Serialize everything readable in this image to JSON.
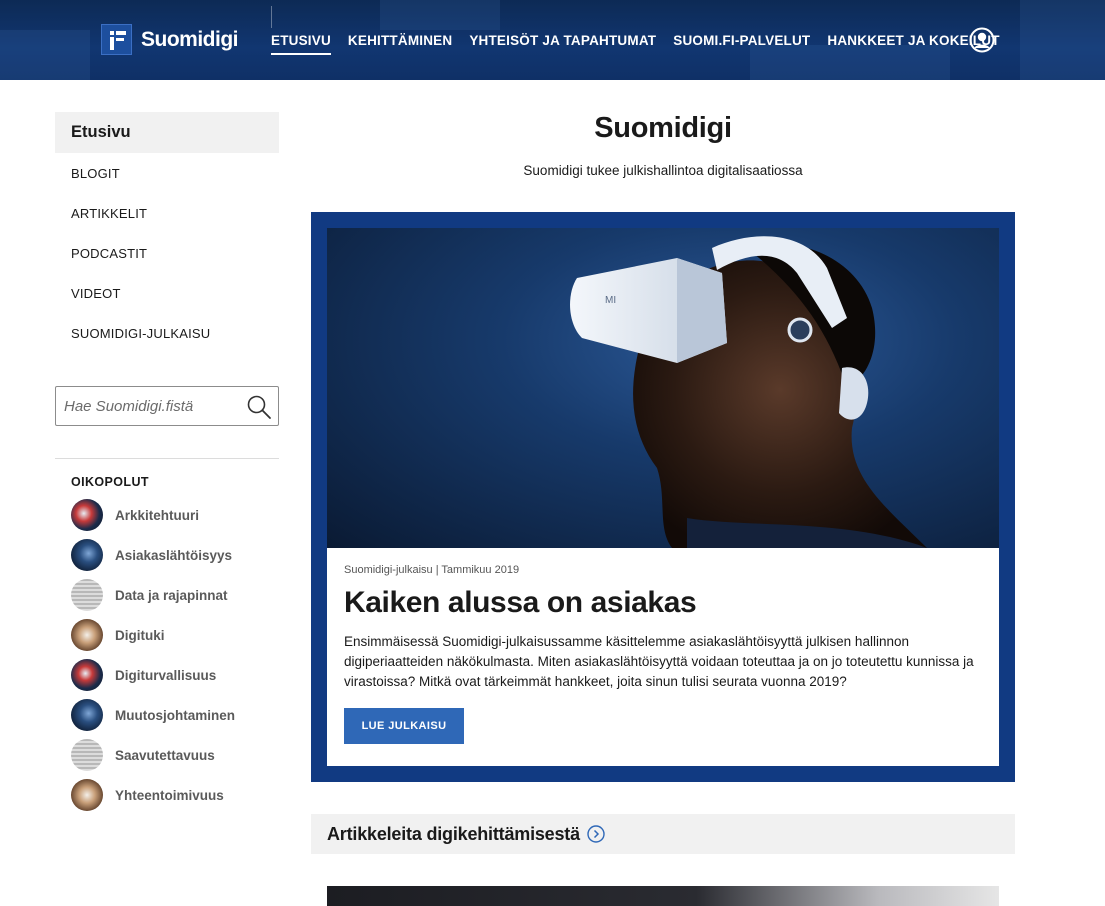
{
  "header": {
    "logo_text": "Suomidigi",
    "nav": [
      {
        "label": "ETUSIVU",
        "active": true
      },
      {
        "label": "KEHITTÄMINEN",
        "active": false
      },
      {
        "label": "YHTEISÖT JA TAPAHTUMAT",
        "active": false
      },
      {
        "label": "SUOMI.FI-PALVELUT",
        "active": false
      },
      {
        "label": "HANKKEET JA KOKEILUT",
        "active": false
      }
    ],
    "user_icon": "user-circle-icon"
  },
  "sidebar": {
    "home_label": "Etusivu",
    "links": [
      "BLOGIT",
      "ARTIKKELIT",
      "PODCASTIT",
      "VIDEOT",
      "SUOMIDIGI-JULKAISU"
    ],
    "search_placeholder": "Hae Suomidigi.fistä",
    "shortcuts_title": "OIKOPOLUT",
    "shortcuts": [
      "Arkkitehtuuri",
      "Asiakaslähtöisyys",
      "Data ja rajapinnat",
      "Digituki",
      "Digiturvallisuus",
      "Muutosjohtaminen",
      "Saavutettavuus",
      "Yhteentoimivuus"
    ]
  },
  "main": {
    "title": "Suomidigi",
    "subtitle": "Suomidigi tukee julkishallintoa digitalisaatiossa",
    "hero": {
      "meta": "Suomidigi-julkaisu | Tammikuu 2019",
      "title": "Kaiken alussa on asiakas",
      "text": "Ensimmäisessä Suomidigi-julkaisussamme käsittelemme asiakaslähtöisyyttä julkisen hallinnon digiperiaatteiden näkökulmasta. Miten asiakaslähtöisyyttä voidaan toteuttaa ja on jo toteutettu kunnissa ja virastoissa? Mitkä ovat tärkeimmät hankkeet, joita sinun tulisi seurata vuonna 2019?",
      "cta_label": "LUE JULKAISU"
    },
    "section_title": "Artikkeleita digikehittämisestä"
  },
  "colors": {
    "header_bg": "#113671",
    "hero_frame": "#113a82",
    "cta": "#2f68b7",
    "accent_link": "#2f68b7"
  }
}
